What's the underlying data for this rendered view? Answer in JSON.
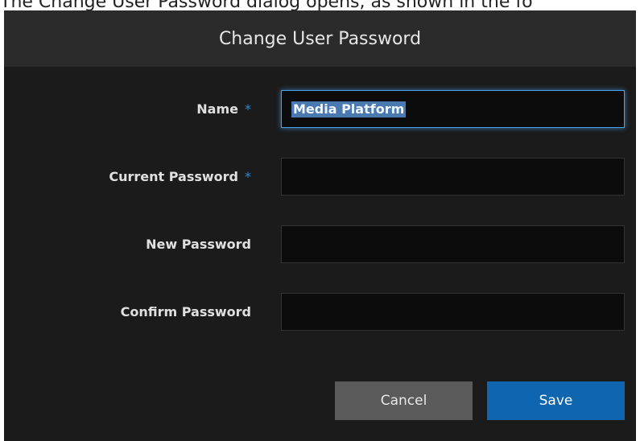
{
  "caption": "The Change User Password dialog opens, as shown in the fo",
  "dialog": {
    "title": "Change User Password",
    "fields": [
      {
        "label": "Name",
        "required_mark": "*",
        "value": "Media Platform"
      },
      {
        "label": "Current Password",
        "required_mark": "*",
        "value": ""
      },
      {
        "label": "New Password",
        "required_mark": "",
        "value": ""
      },
      {
        "label": "Confirm Password",
        "required_mark": "",
        "value": ""
      }
    ],
    "buttons": {
      "cancel": "Cancel",
      "save": "Save"
    }
  },
  "colors": {
    "accent": "#2e8bd6",
    "save_button": "#0f65b0",
    "cancel_button": "#5a5a5a",
    "dialog_bg": "#1b1b1b",
    "header_bg": "#2b2b2b"
  }
}
